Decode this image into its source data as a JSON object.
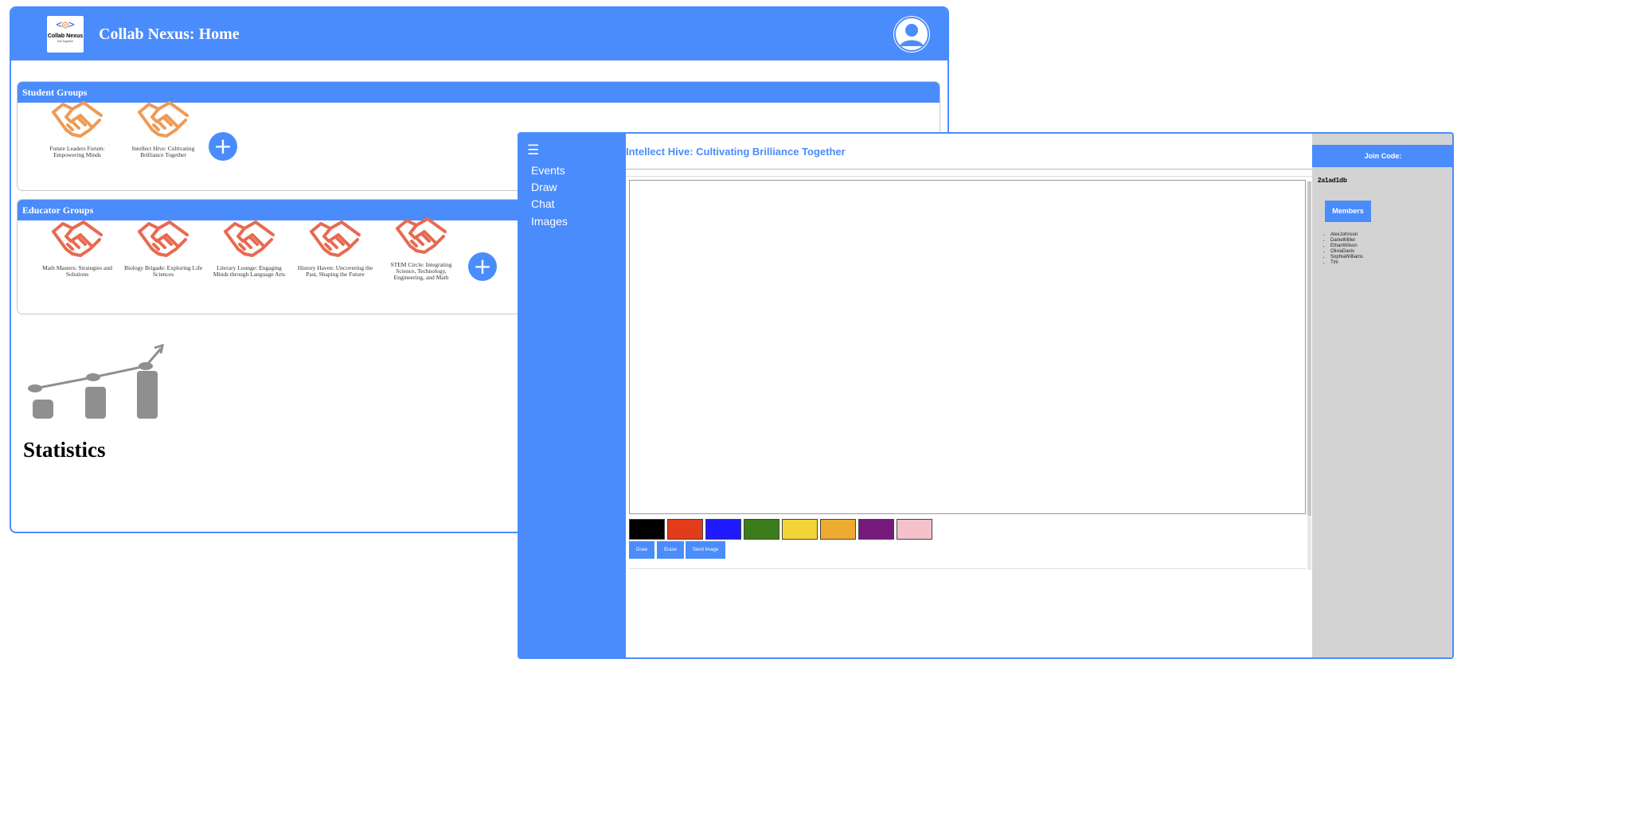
{
  "home": {
    "logo": {
      "glyph_left": "<",
      "glyph_right": ">",
      "name": "Collab Nexus",
      "tagline": "Get Together"
    },
    "title": "Collab Nexus: Home",
    "student_groups": {
      "header": "Student Groups",
      "items": [
        {
          "label": "Future Leaders Forum: Empowering Minds"
        },
        {
          "label": "Intellect Hive: Cultivating Brilliance Together"
        }
      ],
      "add_label": "+"
    },
    "educator_groups": {
      "header": "Educator Groups",
      "items": [
        {
          "label": "Math Masters: Strategies and Solutions"
        },
        {
          "label": "Biology Brigade: Exploring Life Sciences"
        },
        {
          "label": "Literary Lounge: Engaging Minds through Language Arts"
        },
        {
          "label": "History Haven: Uncovering the Past, Shaping the Future"
        },
        {
          "label": "STEM Circle: Integrating Science, Technology, Engineering, and Math"
        }
      ],
      "add_label": "+"
    },
    "statistics_label": "Statistics"
  },
  "group_window": {
    "menu_icon": "☰",
    "nav": [
      "Events",
      "Draw",
      "Chat",
      "Images"
    ],
    "title": "Intellect Hive: Cultivating Brilliance Together",
    "palette": [
      {
        "name": "black",
        "color": "#000000"
      },
      {
        "name": "red",
        "color": "#e23c1c"
      },
      {
        "name": "blue",
        "color": "#1f1aff"
      },
      {
        "name": "green",
        "color": "#3a7d1a"
      },
      {
        "name": "yellow",
        "color": "#f3d436"
      },
      {
        "name": "orange",
        "color": "#eeab31"
      },
      {
        "name": "purple",
        "color": "#771a7d"
      },
      {
        "name": "pink",
        "color": "#f5c2cb"
      }
    ],
    "buttons": {
      "draw": "Draw",
      "erase": "Erase",
      "send_image": "Send Image"
    },
    "join_code_label": "Join Code:",
    "join_code_value": "2a1ad1db",
    "members_button": "Members",
    "members": [
      "AlexJohnson",
      "DanielMiller",
      "EthanWilson",
      "OliviaDavis",
      "SophiaWilliams",
      "Tim"
    ]
  },
  "colors": {
    "accent": "#4a8cfc",
    "student_icon": "#ef9a55",
    "educator_icon": "#e76a50",
    "stats_icon": "#8f8f8f",
    "panel_gray": "#d3d3d3"
  }
}
